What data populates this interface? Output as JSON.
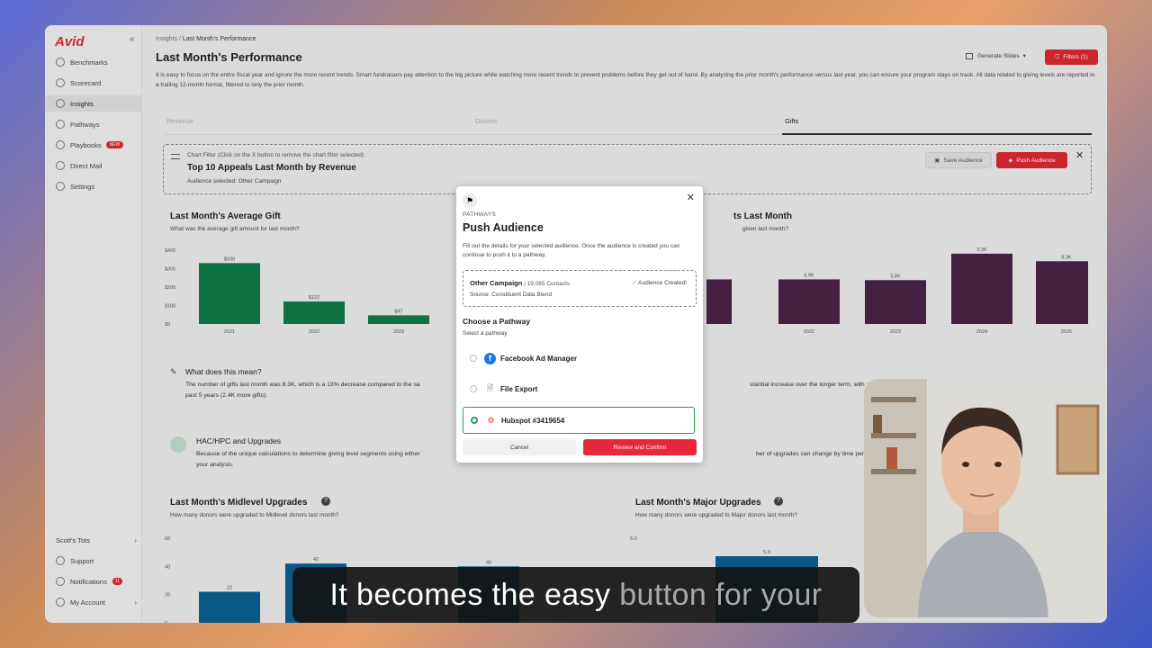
{
  "app": {
    "logo": "Avid"
  },
  "sidebar": {
    "collapse_glyph": "«",
    "items": [
      {
        "label": "Benchmarks",
        "icon": "benchmarks-icon"
      },
      {
        "label": "Scorecard",
        "icon": "scorecard-icon"
      },
      {
        "label": "Insights",
        "icon": "lightbulb-icon",
        "active": true
      },
      {
        "label": "Pathways",
        "icon": "pathways-icon"
      },
      {
        "label": "Playbooks",
        "icon": "book-icon",
        "badge": "NEW"
      },
      {
        "label": "Direct Mail",
        "icon": "mail-icon"
      },
      {
        "label": "Settings",
        "icon": "gear-icon"
      }
    ],
    "bottom": [
      {
        "label": "Scott's Tots"
      },
      {
        "label": "Support"
      },
      {
        "label": "Notifications",
        "badge": "11"
      },
      {
        "label": "My Account"
      }
    ]
  },
  "header": {
    "breadcrumb_root": "Insights",
    "breadcrumb_sep": "/",
    "breadcrumb_current": "Last Month's Performance",
    "title": "Last Month's Performance",
    "description": "It is easy to focus on the entire fiscal year and ignore the more recent trends. Smart fundraisers pay attention to the big picture while watching more recent trends to prevent problems before they get out of hand. By analyzing the prior month's performance versus last year, you can ensure your program stays on track. All data related to giving levels are reported in a trailing 12-month format, filtered to only the prior month.",
    "generate_slides": "Generate Slides",
    "filters": "Filters (1)"
  },
  "tabs": [
    "Revenue",
    "Donors",
    "Gifts"
  ],
  "chart_filter": {
    "hint": "Chart Filter (Click on the X button to remove the chart filter selected)",
    "title": "Top 10 Appeals Last Month by Revenue",
    "audience": "Audience selected: Other Campaign",
    "save": "Save Audience",
    "push": "Push Audience",
    "close": "✕"
  },
  "avg_gift": {
    "title": "Last Month's Average Gift",
    "subtitle": "What was the average gift amount for last month?"
  },
  "gifts_panel": {
    "title": "ts Last Month",
    "subtitle": "given last month?"
  },
  "meaning": {
    "title": "What does this mean?",
    "text_left": "The number of gifts last month was 8.3K, which is a 13% decrease compared to the sa",
    "text_right": "stantial increase over the longer term, with a 43% rise",
    "text_line2": "past 5 years (2.4K more gifts)."
  },
  "hac": {
    "title": "HAC/HPC and Upgrades",
    "text_left": "Because of the unique calculations to determine giving level segments using either",
    "text_right": "ber of upgrades can change by time period. When s",
    "text_line2": "your analysis."
  },
  "midlevel": {
    "title": "Last Month's Midlevel Upgrades",
    "subtitle": "How many donors were upgraded to Midlevel donors last month?"
  },
  "major": {
    "title": "Last Month's Major Upgrades",
    "subtitle": "How many donors were upgraded to Major donors last month?"
  },
  "modal": {
    "category": "PATHWAYS",
    "title": "Push Audience",
    "description": "Fill out the details for your selected audience. Once the audience is created you can continue to push it to a pathway.",
    "audience_name": "Other Campaign",
    "audience_sep": " | ",
    "audience_count": "19,065 Contacts",
    "audience_source": "Source: Constituent Data Blend",
    "audience_status": "Audience Created!",
    "choose_title": "Choose a Pathway",
    "choose_sub": "Select a pathway",
    "options": [
      {
        "label": "Facebook Ad Manager",
        "icon": "facebook-icon",
        "selected": false
      },
      {
        "label": "File Export",
        "icon": "file-icon",
        "selected": false
      },
      {
        "label": "Hubspot #3419654",
        "icon": "hubspot-icon",
        "selected": true
      }
    ],
    "cancel": "Cancel",
    "confirm": "Review and Confirm",
    "close": "✕"
  },
  "caption": {
    "bright": "It becomes the easy ",
    "dim": "button for your"
  },
  "colors": {
    "accent": "#d9292f",
    "green": "#107a4a",
    "purple": "#4a2244",
    "blue": "#0b5e8f",
    "selected": "#2a9a5a"
  },
  "chart_data": [
    {
      "type": "bar",
      "title": "Last Month's Average Gift",
      "categories": [
        "2021",
        "2022",
        "2023"
      ],
      "values": [
        330,
        122,
        47
      ],
      "data_labels": [
        "$330",
        "$122",
        "$47"
      ],
      "ytick_labels": [
        "$400",
        "$300",
        "$200",
        "$100",
        "$0"
      ],
      "ylim": [
        0,
        400
      ],
      "color": "#107a4a"
    },
    {
      "type": "bar",
      "title": "ts Last Month",
      "categories": [
        "",
        "2022",
        "2023",
        "2024",
        "2025"
      ],
      "values": [
        5.9,
        5.9,
        5.8,
        9.3,
        8.3
      ],
      "data_labels": [
        "",
        "5.9K",
        "5.8K",
        "9.3K",
        "8.3K"
      ],
      "category_labels": [
        "",
        "2022",
        "2023",
        "2024",
        "2025"
      ],
      "ylim": [
        0,
        10
      ],
      "color": "#4a2244"
    },
    {
      "type": "bar",
      "title": "Last Month's Midlevel Upgrades",
      "values": [
        22,
        42,
        40
      ],
      "data_labels": [
        "22",
        "42",
        "40"
      ],
      "ytick_labels": [
        "60",
        "40",
        "20",
        "0"
      ],
      "ylim": [
        0,
        60
      ],
      "color": "#0b5e8f"
    },
    {
      "type": "bar",
      "title": "Last Month's Major Upgrades",
      "values": [
        5.0
      ],
      "data_labels": [
        "5.0"
      ],
      "ytick_labels": [
        "6.0",
        "4.0"
      ],
      "ylim": [
        0,
        6
      ],
      "color": "#0b5e8f"
    }
  ]
}
